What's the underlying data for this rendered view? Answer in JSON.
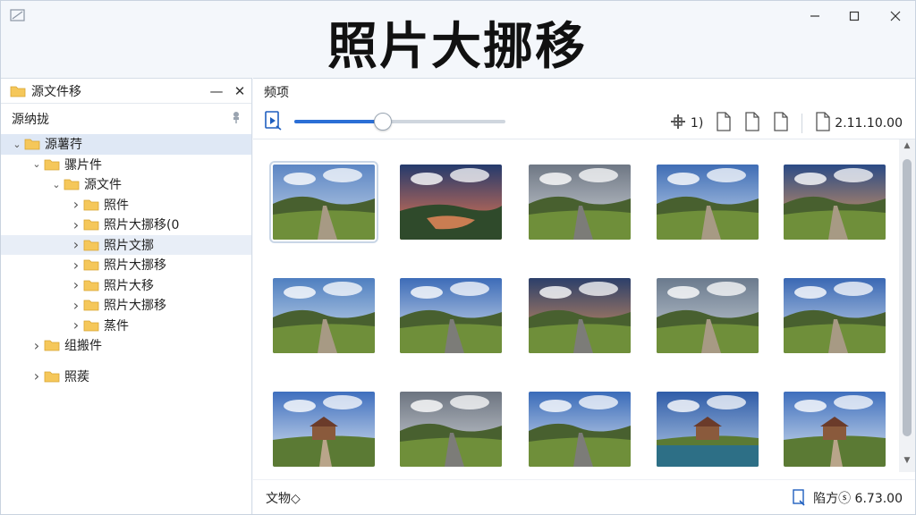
{
  "window": {
    "title": "照片大挪移",
    "controls": {
      "minimize": "minimize-icon",
      "maximize": "maximize-icon",
      "close": "close-icon"
    }
  },
  "left_pane": {
    "header": "源文件移",
    "header_controls": [
      "—",
      "✕"
    ],
    "subheader": "源纳拢",
    "tree": [
      {
        "label": "源薯荇",
        "level": 0,
        "expanded": true,
        "selected": true
      },
      {
        "label": "骡片件",
        "level": 1,
        "expanded": true
      },
      {
        "label": "源文件",
        "level": 2,
        "expanded": true
      },
      {
        "label": "照件",
        "level": 3,
        "expanded": false
      },
      {
        "label": "照片大挪移(0",
        "level": 3,
        "expanded": false
      },
      {
        "label": "照片文挪",
        "level": 3,
        "expanded": false,
        "hover": true
      },
      {
        "label": "照片大挪移",
        "level": 3,
        "expanded": false
      },
      {
        "label": "照片大移",
        "level": 3,
        "expanded": false
      },
      {
        "label": "照片大挪移",
        "level": 3,
        "expanded": false
      },
      {
        "label": "蒸件",
        "level": 3,
        "expanded": false
      },
      {
        "label": "组搬件",
        "level": 1,
        "expanded": false
      },
      {
        "label": "照蒺",
        "level": 1,
        "expanded": false
      }
    ]
  },
  "right_pane": {
    "header": "频项",
    "zoom_slider": {
      "value_fraction": 0.42
    },
    "toolbar_items": [
      {
        "icon": "move-icon",
        "label": "1)"
      },
      {
        "icon": "file-icon",
        "label": ""
      },
      {
        "icon": "file-icon",
        "label": ""
      },
      {
        "icon": "file-icon",
        "label": ""
      },
      {
        "icon": "file-icon",
        "label": "2.11.10.00"
      }
    ],
    "thumbnails": [
      {
        "scene": "green hills under cloudy sky",
        "selected": true
      },
      {
        "scene": "sunset over lake"
      },
      {
        "scene": "road through valley under clouds"
      },
      {
        "scene": "dirt road through meadow"
      },
      {
        "scene": "sunset path in grassland"
      },
      {
        "scene": "winding stream in valley"
      },
      {
        "scene": "road into hills"
      },
      {
        "scene": "stone path at dusk"
      },
      {
        "scene": "path through green valley"
      },
      {
        "scene": "cobblestone path to hills"
      },
      {
        "scene": "house on hilltop"
      },
      {
        "scene": "road to horizon"
      },
      {
        "scene": "track through meadow"
      },
      {
        "scene": "farmhouse by lake with mountains"
      },
      {
        "scene": "farmhouse at end of path"
      }
    ],
    "status_left": "文物◇",
    "status_right": "陷方ⓢ 6.73.00"
  }
}
